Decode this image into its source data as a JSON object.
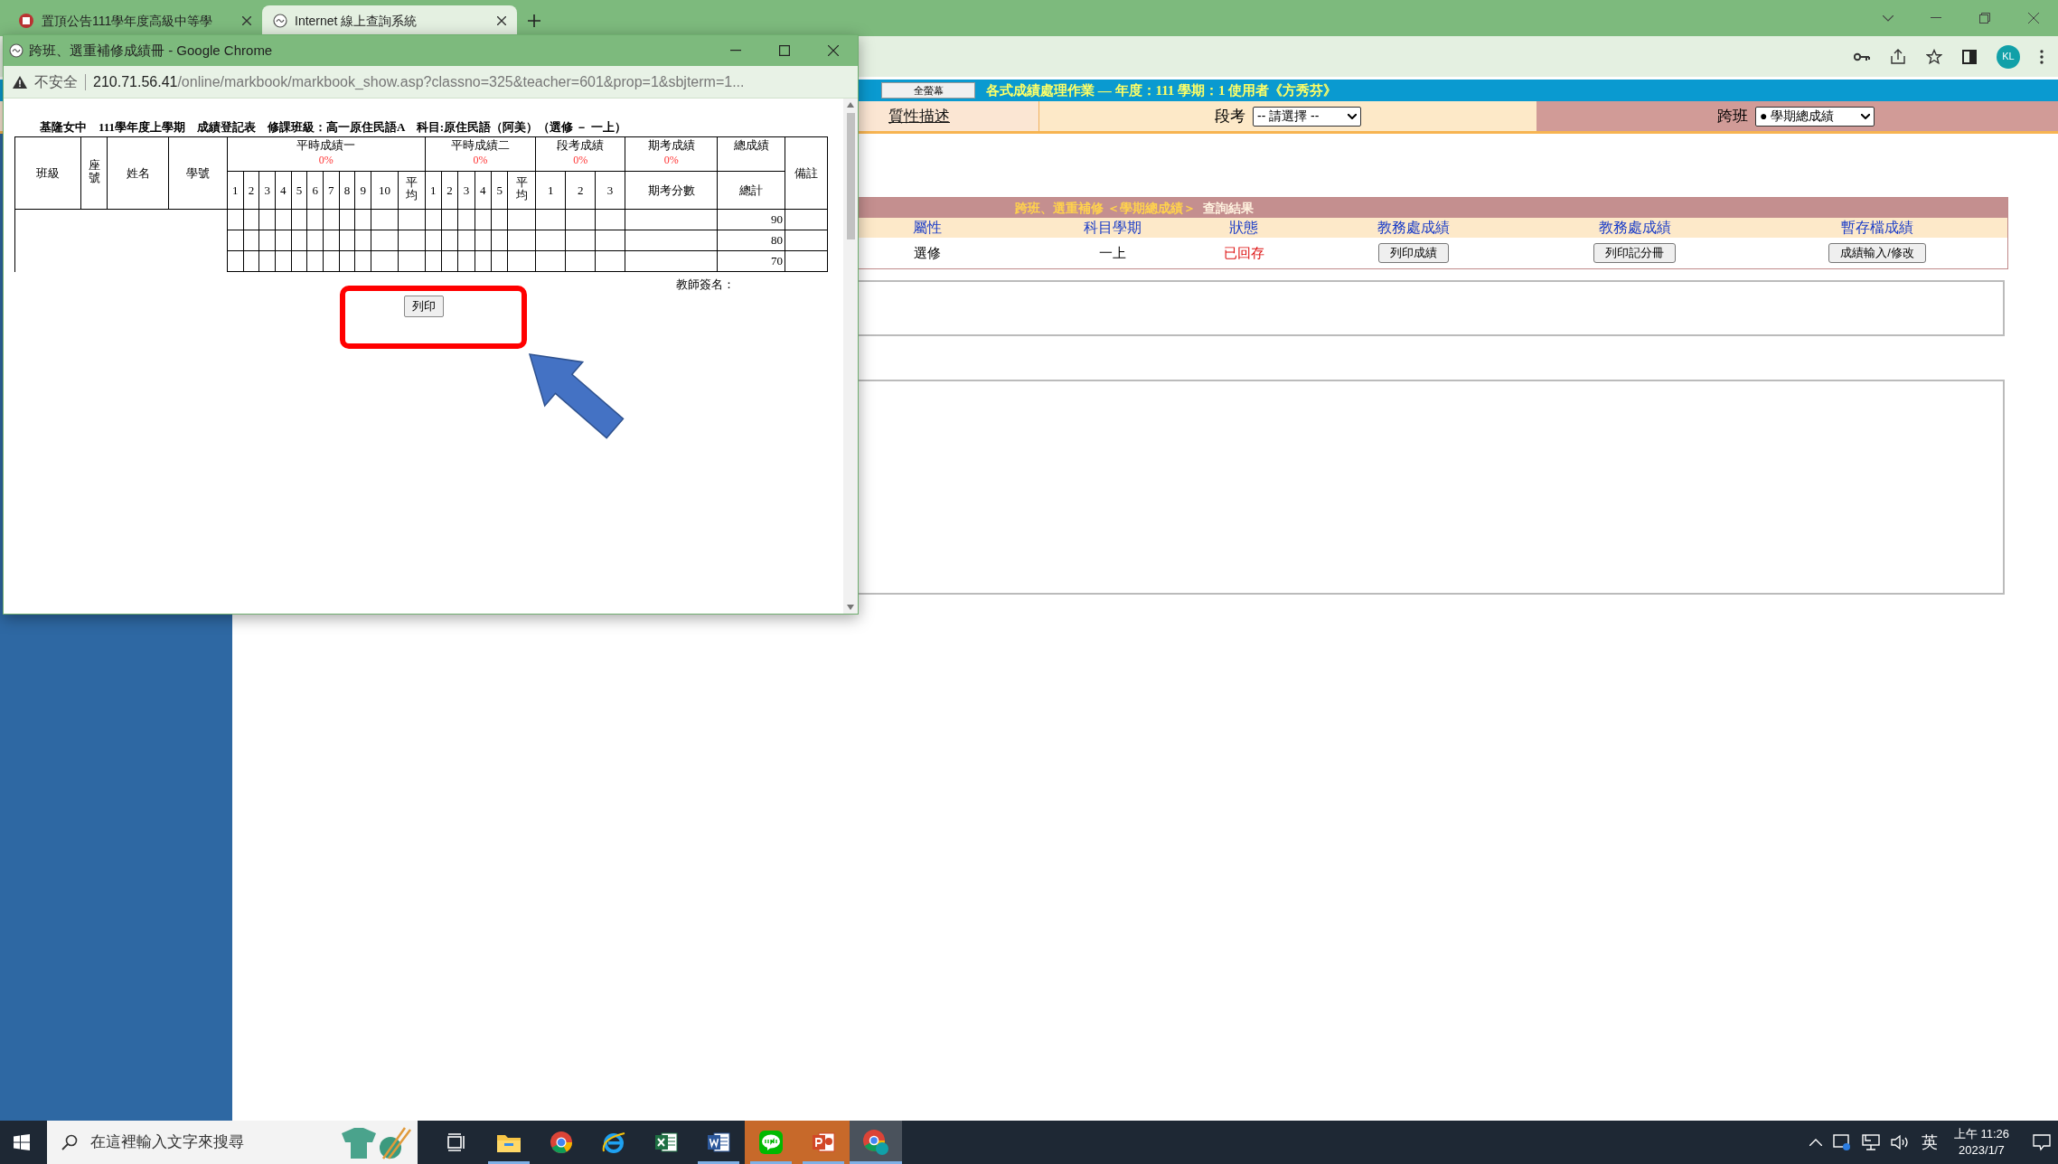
{
  "browser": {
    "tabs": [
      {
        "title": "置頂公告111學年度高級中等學",
        "selected": false
      },
      {
        "title": "Internet 線上查詢系統",
        "selected": true
      }
    ],
    "profile": "KL"
  },
  "page": {
    "banner": {
      "button": "全螢幕",
      "title": "各式成績處理作業 — 年度：111 學期：1 使用者《方秀芬》"
    },
    "filters": {
      "link": "質性描述",
      "exam_label": "段考",
      "exam_value": "-- 請選擇 --",
      "cross_label": "跨班",
      "cross_value": "● 學期總成績"
    },
    "results": {
      "title": "跨班、選重補修 ＜學期總成績＞",
      "title_suffix": "查詢結果",
      "columns": [
        "屬性",
        "科目學期",
        "狀態",
        "教務處成績",
        "教務處成績",
        "暫存檔成績"
      ],
      "row": [
        {
          "kind": "text",
          "text": "選修"
        },
        {
          "kind": "text",
          "text": "一上"
        },
        {
          "kind": "status",
          "text": "已回存"
        },
        {
          "kind": "button",
          "text": "列印成績"
        },
        {
          "kind": "button",
          "text": "列印記分冊"
        },
        {
          "kind": "button",
          "text": "成績輸入/修改"
        }
      ]
    }
  },
  "popup": {
    "title": "跨班、選重補修成績冊 - Google Chrome",
    "security": "不安全",
    "url_host": "210.71.56.41",
    "url_path": "/online/markbook/markbook_show.asp?classno=325&teacher=601&prop=1&sbjterm=1...",
    "heading": "基隆女中　111學年度上學期　成績登記表　修課班級：高一原住民語A　科目:原住民語（阿美）（選修 － 一上）",
    "fixed_columns": [
      "班級",
      "座號",
      "姓名",
      "學號"
    ],
    "groups": [
      {
        "kind": "score",
        "title": "平時成績一",
        "weight": "0%",
        "subs": [
          "1",
          "2",
          "3",
          "4",
          "5",
          "6",
          "7",
          "8",
          "9",
          "10",
          "平均"
        ]
      },
      {
        "kind": "score",
        "title": "平時成績二",
        "weight": "0%",
        "subs": [
          "1",
          "2",
          "3",
          "4",
          "5",
          "平均"
        ]
      },
      {
        "kind": "score",
        "title": "段考成績",
        "weight": "0%",
        "subs": [
          "1",
          "2",
          "3"
        ]
      },
      {
        "kind": "score",
        "title": "期考成績",
        "weight": "0%",
        "subs": [
          "期考分數"
        ]
      },
      {
        "kind": "total",
        "title": "總成績",
        "subs": [
          "總計"
        ]
      }
    ],
    "remarks": "備註",
    "totals": [
      "90",
      "80",
      "70"
    ],
    "signature": "教師簽名：",
    "print_button": "列印"
  },
  "taskbar": {
    "search_placeholder": "在這裡輸入文字來搜尋",
    "apps": [
      {
        "kind": "taskview",
        "running": false,
        "flashing": false,
        "selected": false
      },
      {
        "kind": "explorer",
        "running": true,
        "flashing": false,
        "selected": false
      },
      {
        "kind": "chrome",
        "running": false,
        "flashing": false,
        "selected": false
      },
      {
        "kind": "ie",
        "running": false,
        "flashing": false,
        "selected": false
      },
      {
        "kind": "excel",
        "running": false,
        "flashing": false,
        "selected": false
      },
      {
        "kind": "word",
        "running": true,
        "flashing": false,
        "selected": false
      },
      {
        "kind": "line",
        "running": true,
        "flashing": true,
        "selected": false
      },
      {
        "kind": "powerpoint",
        "running": true,
        "flashing": true,
        "selected": false
      },
      {
        "kind": "chrome-profile",
        "running": true,
        "flashing": false,
        "selected": true
      }
    ],
    "ime": "英",
    "time": "上午 11:26",
    "date": "2023/1/7"
  }
}
